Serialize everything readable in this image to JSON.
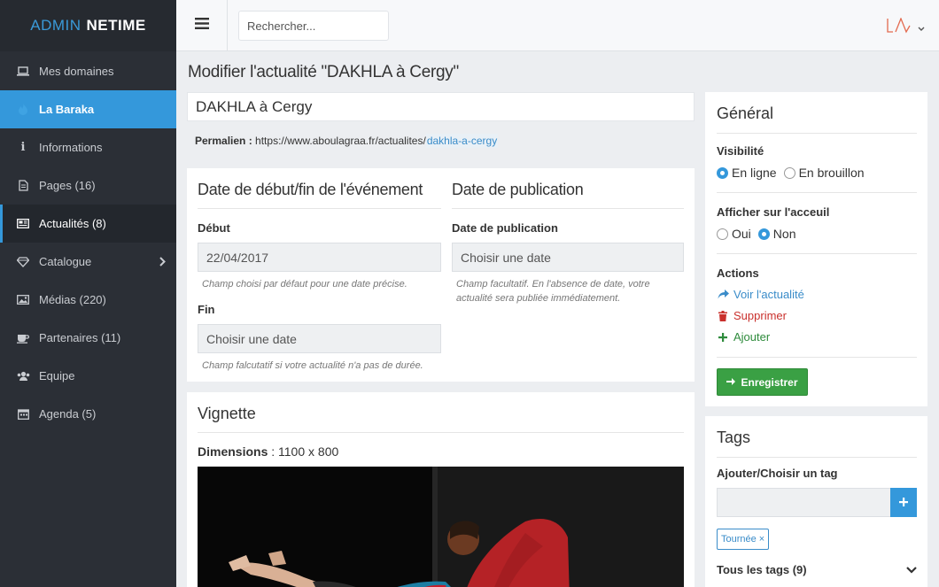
{
  "brand": {
    "part1": "ADMIN",
    "part2": "NETIME"
  },
  "sidebar": {
    "items": [
      {
        "label": "Mes domaines",
        "icon": "laptop-icon"
      },
      {
        "label": "La Baraka",
        "icon": "fire-icon"
      },
      {
        "label": "Informations",
        "icon": "info-icon"
      },
      {
        "label": "Pages (16)",
        "icon": "file-icon"
      },
      {
        "label": "Actualités (8)",
        "icon": "newspaper-icon"
      },
      {
        "label": "Catalogue",
        "icon": "diamond-icon"
      },
      {
        "label": "Médias (220)",
        "icon": "image-icon"
      },
      {
        "label": "Partenaires (11)",
        "icon": "coffee-icon"
      },
      {
        "label": "Equipe",
        "icon": "users-icon"
      },
      {
        "label": "Agenda (5)",
        "icon": "calendar-icon"
      }
    ]
  },
  "topbar": {
    "search_placeholder": "Rechercher..."
  },
  "page": {
    "title": "Modifier l'actualité \"DAKHLA à Cergy\"",
    "title_value": "DAKHLA à Cergy",
    "permalink_label": "Permalien :",
    "permalink_base": "https://www.aboulagraa.fr/actualites/",
    "permalink_slug": "dakhla-a-cergy"
  },
  "dates": {
    "event_title": "Date de début/fin de l'événement",
    "start_label": "Début",
    "start_value": "22/04/2017",
    "start_help": "Champ choisi par défaut pour une date précise.",
    "end_label": "Fin",
    "end_placeholder": "Choisir une date",
    "end_help": "Champ falcutatif si votre actualité n'a pas de durée.",
    "pub_title": "Date de publication",
    "pub_label": "Date de publication",
    "pub_placeholder": "Choisir une date",
    "pub_help": "Champ facultatif. En l'absence de date, votre actualité sera publiée immédiatement."
  },
  "vignette": {
    "title": "Vignette",
    "dims_label": "Dimensions",
    "dims_value": " : 1100 x 800"
  },
  "general": {
    "title": "Général",
    "visibility_label": "Visibilité",
    "visibility_online": "En ligne",
    "visibility_draft": "En brouillon",
    "home_label": "Afficher sur l'acceuil",
    "home_yes": "Oui",
    "home_no": "Non",
    "actions_label": "Actions",
    "action_view": "Voir l'actualité",
    "action_delete": "Supprimer",
    "action_add": "Ajouter",
    "save_label": "Enregistrer"
  },
  "tags": {
    "title": "Tags",
    "add_label": "Ajouter/Choisir un tag",
    "chip": "Tournée ×",
    "all_label": "Tous les tags (9)"
  },
  "colors": {
    "accent": "#3498db",
    "sidebar": "#2b2f36",
    "success": "#3aa044",
    "danger": "#c9302c"
  }
}
